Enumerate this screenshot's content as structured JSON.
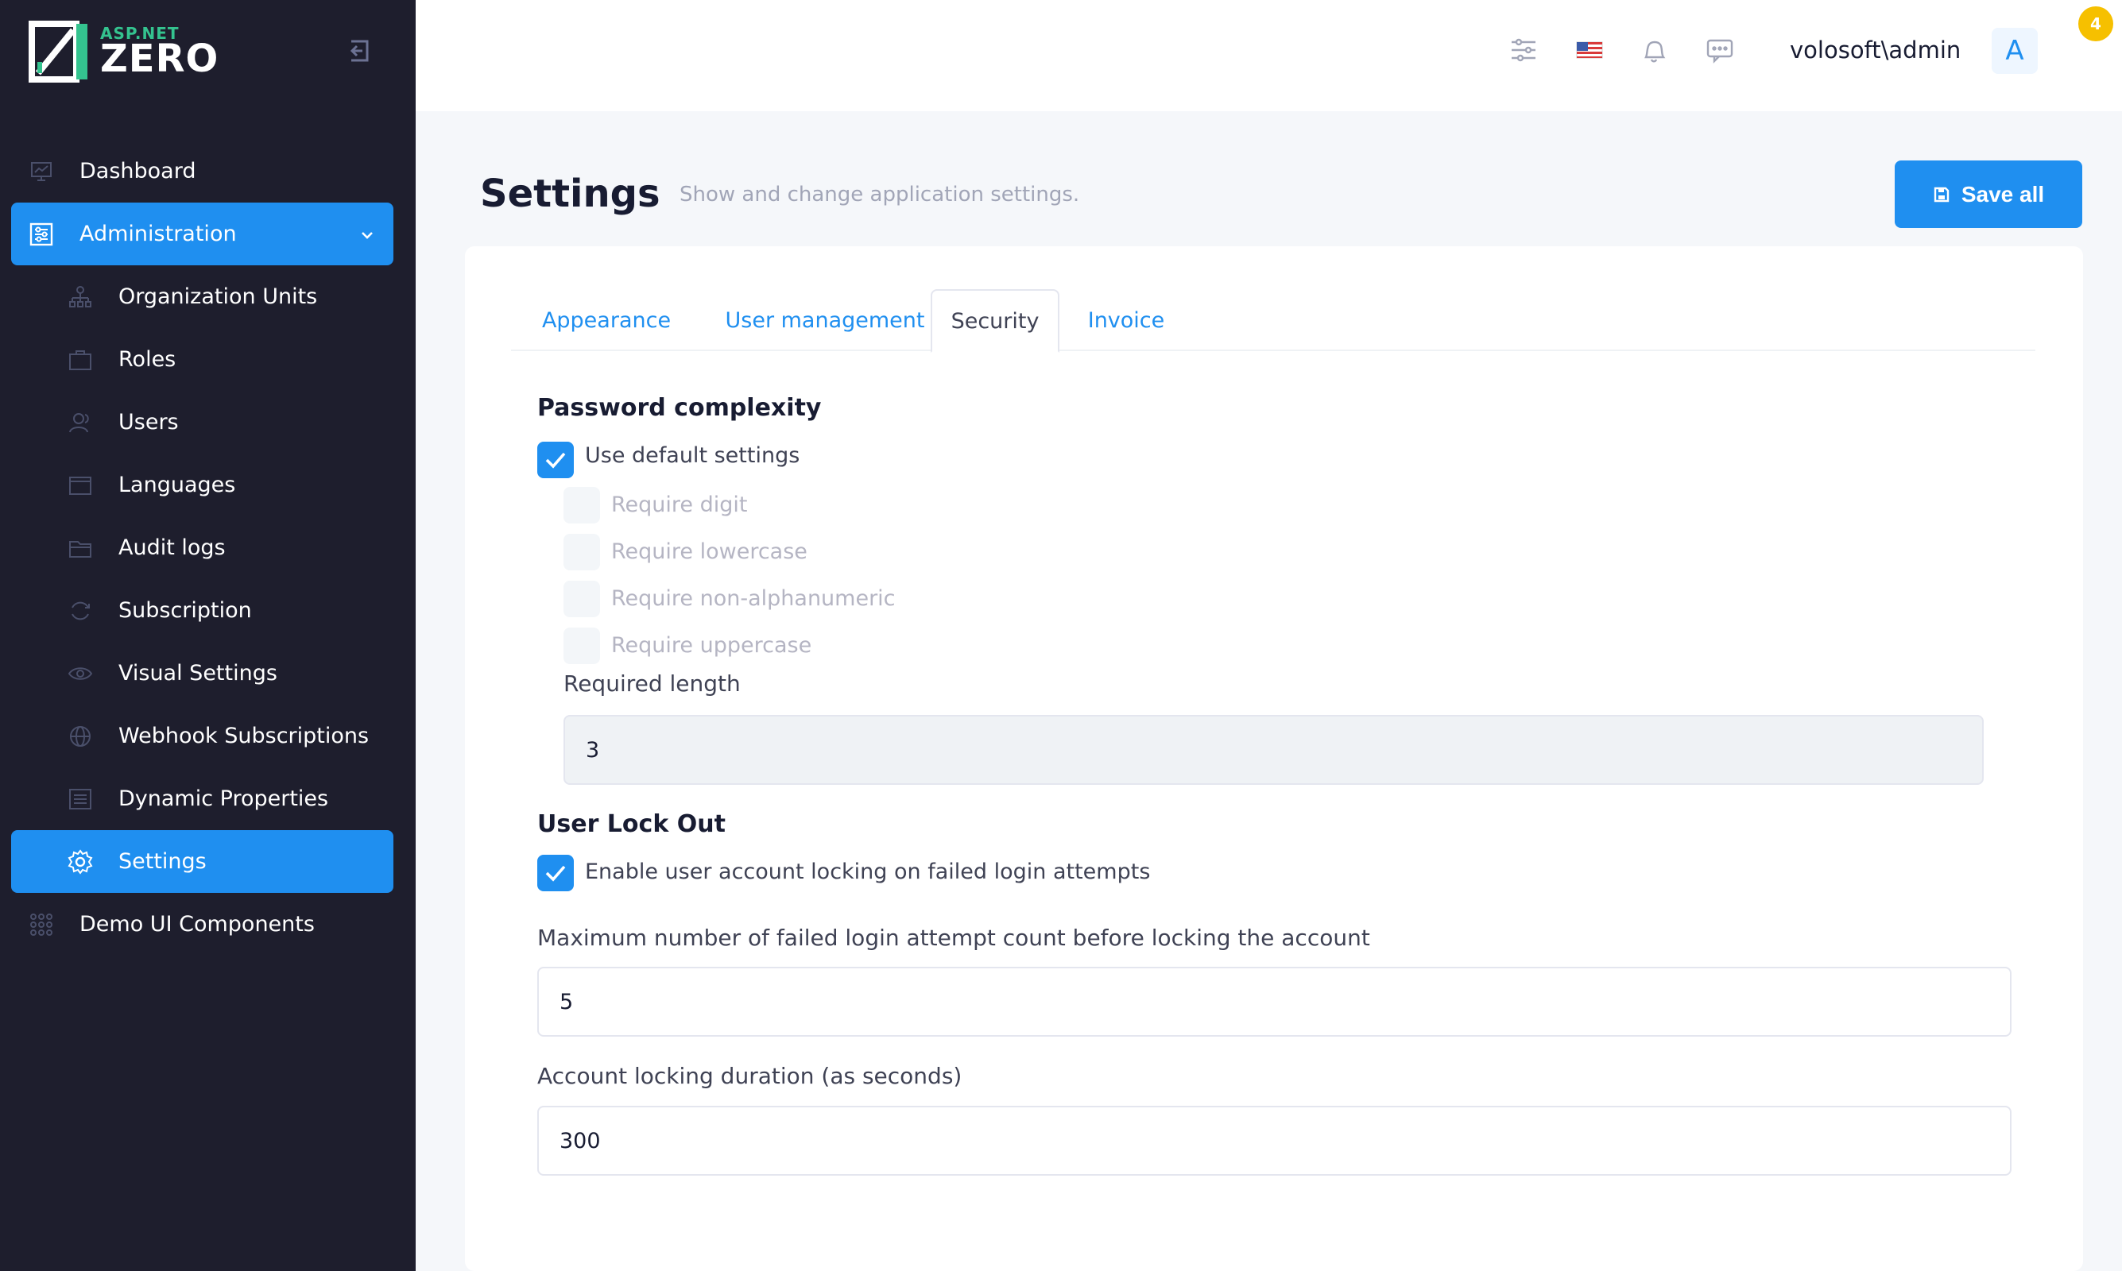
{
  "brand": {
    "small": "ASP.NET",
    "big": "ZERO"
  },
  "sidebar": {
    "items": [
      {
        "label": "Dashboard"
      },
      {
        "label": "Administration"
      },
      {
        "label": "Organization Units"
      },
      {
        "label": "Roles"
      },
      {
        "label": "Users"
      },
      {
        "label": "Languages"
      },
      {
        "label": "Audit logs"
      },
      {
        "label": "Subscription"
      },
      {
        "label": "Visual Settings"
      },
      {
        "label": "Webhook Subscriptions"
      },
      {
        "label": "Dynamic Properties"
      },
      {
        "label": "Settings"
      },
      {
        "label": "Demo UI Components"
      }
    ]
  },
  "topbar": {
    "notification_count": "4",
    "username": "volosoft\\admin",
    "avatar_letter": "A"
  },
  "page": {
    "title": "Settings",
    "subtitle": "Show and change application settings.",
    "save_label": "Save all"
  },
  "tabs": [
    {
      "label": "Appearance"
    },
    {
      "label": "User management"
    },
    {
      "label": "Security"
    },
    {
      "label": "Invoice"
    }
  ],
  "password": {
    "title": "Password complexity",
    "use_default": "Use default settings",
    "require_digit": "Require digit",
    "require_lowercase": "Require lowercase",
    "require_nonalpha": "Require non-alphanumeric",
    "require_uppercase": "Require uppercase",
    "required_length_label": "Required length",
    "required_length_value": "3"
  },
  "lockout": {
    "title": "User Lock Out",
    "enable_label": "Enable user account locking on failed login attempts",
    "max_attempts_label": "Maximum number of failed login attempt count before locking the account",
    "max_attempts_value": "5",
    "duration_label": "Account locking duration (as seconds)",
    "duration_value": "300"
  },
  "colors": {
    "accent": "#1f8ff0",
    "sidebar_bg": "#1e1e2d",
    "badge": "#f6c000"
  }
}
